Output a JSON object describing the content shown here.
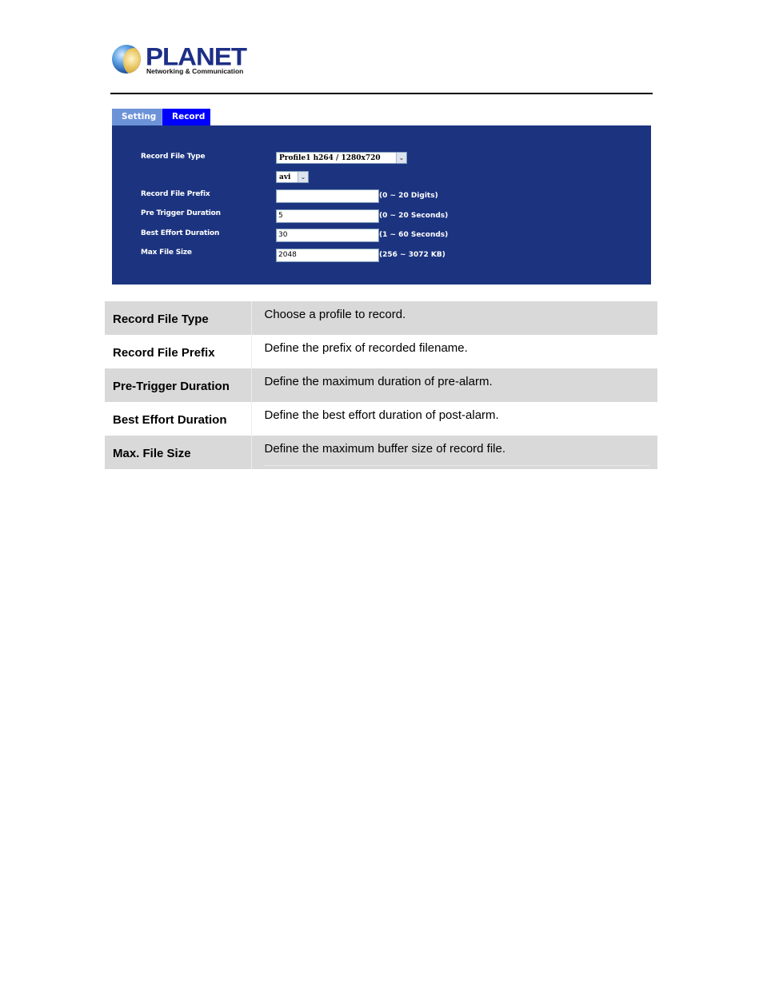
{
  "brand": {
    "name": "PLANET",
    "tagline": "Networking & Communication"
  },
  "tabs": [
    {
      "label": "Setting",
      "active": false,
      "color": "#6c93d8"
    },
    {
      "label": "Record",
      "active": true,
      "color": "#0000ff"
    }
  ],
  "panel": {
    "background": "#1c347f",
    "fields": {
      "record_file_type": {
        "label": "Record File Type",
        "profile_value": "Profile1 h264 / 1280x720",
        "format_value": "avi"
      },
      "record_file_prefix": {
        "label": "Record File Prefix",
        "value": "",
        "hint": "(0 ~ 20 Digits)"
      },
      "pre_trigger_duration": {
        "label": "Pre Trigger Duration",
        "value": "5",
        "hint": "(0 ~ 20 Seconds)"
      },
      "best_effort_duration": {
        "label": "Best Effort Duration",
        "value": "30",
        "hint": "(1 ~ 60 Seconds)"
      },
      "max_file_size": {
        "label": "Max File Size",
        "value": "2048",
        "hint": "(256 ~ 3072 KB)"
      }
    }
  },
  "descriptions": [
    {
      "name": "Record File Type",
      "text": "Choose a profile to record."
    },
    {
      "name": "Record File Prefix",
      "text": "Define the prefix of recorded filename."
    },
    {
      "name": "Pre-Trigger Duration",
      "text": "Define the maximum duration of pre-alarm."
    },
    {
      "name": "Best Effort Duration",
      "text": "Define the best effort duration of post-alarm."
    },
    {
      "name": "Max. File Size",
      "text": "Define the maximum buffer size of record file."
    }
  ]
}
